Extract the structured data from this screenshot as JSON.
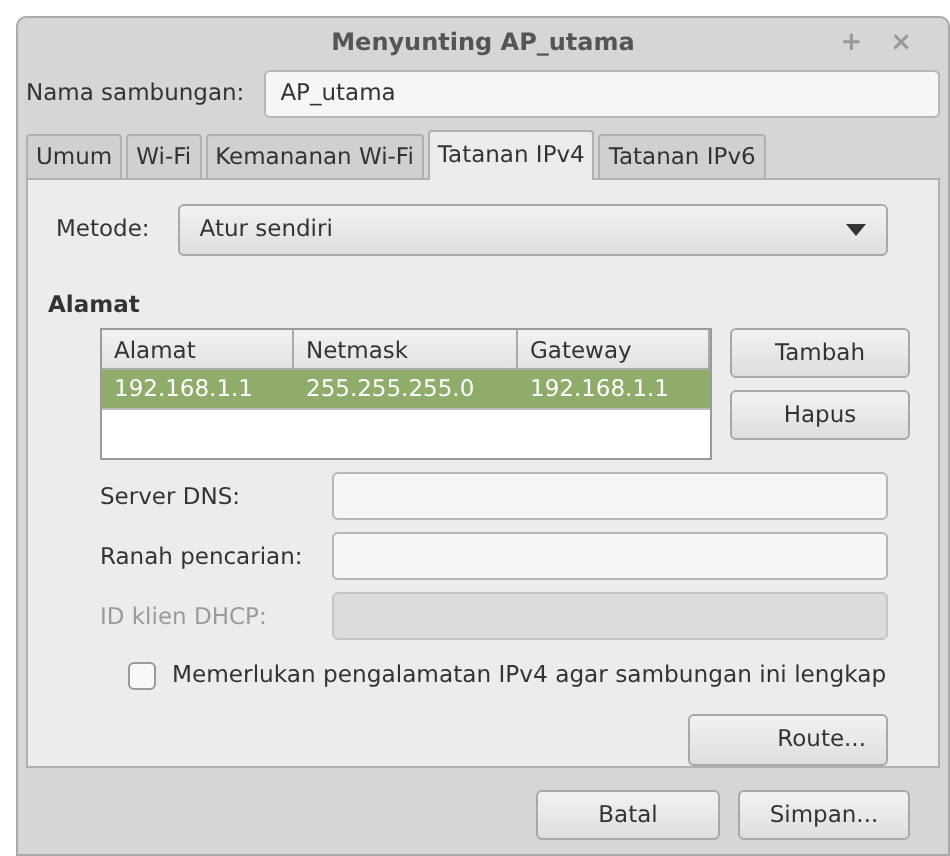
{
  "window": {
    "title": "Menyunting AP_utama",
    "controls": [
      "+",
      "×"
    ]
  },
  "connection_name": {
    "label": "Nama sambungan:",
    "value": "AP_utama"
  },
  "tabs": [
    {
      "label": "Umum",
      "selected": false
    },
    {
      "label": "Wi-Fi",
      "selected": false
    },
    {
      "label": "Kemananan Wi-Fi",
      "selected": false
    },
    {
      "label": "Tatanan IPv4",
      "selected": true
    },
    {
      "label": "Tatanan IPv6",
      "selected": false
    }
  ],
  "method": {
    "label": "Metode:",
    "value": "Atur sendiri"
  },
  "addresses": {
    "heading": "Alamat",
    "columns": [
      "Alamat",
      "Netmask",
      "Gateway"
    ],
    "rows": [
      {
        "cells": [
          "192.168.1.1",
          "255.255.255.0",
          "192.168.1.1"
        ],
        "selected": true
      }
    ],
    "buttons": [
      "Tambah",
      "Hapus"
    ]
  },
  "fields": [
    {
      "label": "Server DNS:",
      "disabled": false
    },
    {
      "label": "Ranah pencarian:",
      "disabled": false
    },
    {
      "label": "ID klien DHCP:",
      "disabled": true
    }
  ],
  "require_checkbox": {
    "label": "Memerlukan pengalamatan IPv4 agar sambungan ini lengkap",
    "checked": false
  },
  "route_button": "Route...",
  "footer_buttons": [
    "Batal",
    "Simpan..."
  ]
}
